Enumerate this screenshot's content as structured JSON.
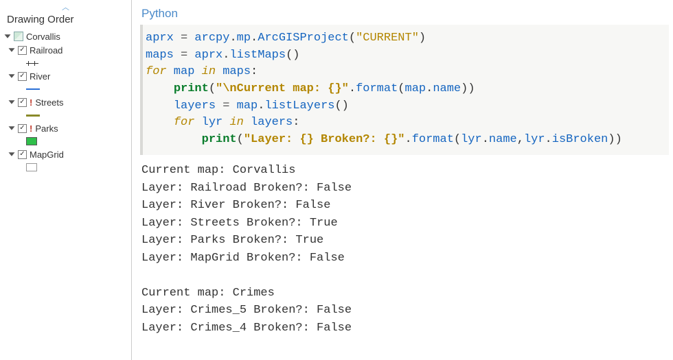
{
  "sidebar": {
    "title": "Drawing Order",
    "map_name": "Corvallis",
    "layers": [
      {
        "name": "Railroad",
        "warn": false,
        "swatch": "rail"
      },
      {
        "name": "River",
        "warn": false,
        "swatch": "blue"
      },
      {
        "name": "Streets",
        "warn": true,
        "swatch": "olive"
      },
      {
        "name": "Parks",
        "warn": true,
        "swatch": "green"
      },
      {
        "name": "MapGrid",
        "warn": false,
        "swatch": "empty"
      }
    ]
  },
  "python_header": "Python",
  "code": {
    "l1_a": "aprx",
    "l1_b": " = ",
    "l1_c": "arcpy",
    "l1_d": ".",
    "l1_e": "mp",
    "l1_f": ".",
    "l1_g": "ArcGISProject",
    "l1_h": "(",
    "l1_i": "\"CURRENT\"",
    "l1_j": ")",
    "l2_a": "maps",
    "l2_b": " = ",
    "l2_c": "aprx",
    "l2_d": ".",
    "l2_e": "listMaps",
    "l2_f": "()",
    "l3_a": "for",
    "l3_b": " map ",
    "l3_c": "in",
    "l3_d": " maps",
    "l3_e": ":",
    "l4_a": "    ",
    "l4_b": "print",
    "l4_c": "(",
    "l4_d": "\"\\nCurrent map: {}\"",
    "l4_e": ".",
    "l4_f": "format",
    "l4_g": "(",
    "l4_h": "map",
    "l4_i": ".",
    "l4_j": "name",
    "l4_k": "))",
    "l5_a": "    ",
    "l5_b": "layers",
    "l5_c": " = ",
    "l5_d": "map",
    "l5_e": ".",
    "l5_f": "listLayers",
    "l5_g": "()",
    "l6_a": "    ",
    "l6_b": "for",
    "l6_c": " lyr ",
    "l6_d": "in",
    "l6_e": " layers",
    "l6_f": ":",
    "l7_a": "        ",
    "l7_b": "print",
    "l7_c": "(",
    "l7_d": "\"Layer: {} Broken?: {}\"",
    "l7_e": ".",
    "l7_f": "format",
    "l7_g": "(",
    "l7_h": "lyr",
    "l7_i": ".",
    "l7_j": "name",
    "l7_k": ",",
    "l7_l": "lyr",
    "l7_m": ".",
    "l7_n": "isBroken",
    "l7_o": "))"
  },
  "output_lines": [
    "Current map: Corvallis",
    "Layer: Railroad Broken?: False",
    "Layer: River Broken?: False",
    "Layer: Streets Broken?: True",
    "Layer: Parks Broken?: True",
    "Layer: MapGrid Broken?: False",
    "",
    "Current map: Crimes",
    "Layer: Crimes_5 Broken?: False",
    "Layer: Crimes_4 Broken?: False"
  ]
}
